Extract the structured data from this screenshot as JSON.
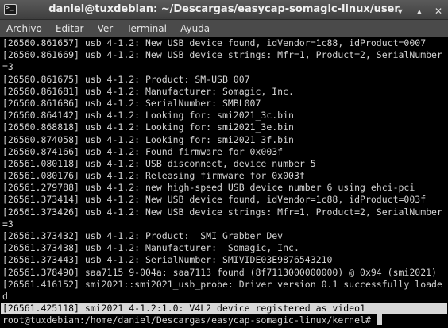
{
  "window": {
    "title": "daniel@tuxdebian: ~/Descargas/easycap-somagic-linux/user",
    "buttons": {
      "minimize": "▾",
      "maximize": "▴",
      "close": "✕"
    }
  },
  "menu": [
    "Archivo",
    "Editar",
    "Ver",
    "Terminal",
    "Ayuda"
  ],
  "terminal": {
    "lines": [
      "[26560.861657] usb 4-1.2: New USB device found, idVendor=1c88, idProduct=0007",
      "[26560.861669] usb 4-1.2: New USB device strings: Mfr=1, Product=2, SerialNumber",
      "=3",
      "[26560.861675] usb 4-1.2: Product: SM-USB 007",
      "[26560.861681] usb 4-1.2: Manufacturer: Somagic, Inc.",
      "[26560.861686] usb 4-1.2: SerialNumber: SMBL007",
      "[26560.864142] usb 4-1.2: Looking for: smi2021_3c.bin",
      "[26560.868818] usb 4-1.2: Looking for: smi2021_3e.bin",
      "[26560.874058] usb 4-1.2: Looking for: smi2021_3f.bin",
      "[26560.874166] usb 4-1.2: Found firmware for 0x003f",
      "[26561.080118] usb 4-1.2: USB disconnect, device number 5",
      "[26561.080176] usb 4-1.2: Releasing firmware for 0x003f",
      "[26561.279788] usb 4-1.2: new high-speed USB device number 6 using ehci-pci",
      "[26561.373414] usb 4-1.2: New USB device found, idVendor=1c88, idProduct=003f",
      "[26561.373426] usb 4-1.2: New USB device strings: Mfr=1, Product=2, SerialNumber",
      "=3",
      "[26561.373432] usb 4-1.2: Product:  SMI Grabber Dev",
      "[26561.373438] usb 4-1.2: Manufacturer:  Somagic, Inc.",
      "[26561.373443] usb 4-1.2: SerialNumber: SMIVIDE03E9876543210",
      "[26561.378490] saa7115 9-004a: saa7113 found (8f7113000000000) @ 0x94 (smi2021)",
      "[26561.416152] smi2021::smi2021_usb_probe: Driver version 0.1 successfully loade",
      "d"
    ],
    "selected_line": "[26561.425118] smi2021 4-1.2:1.0: V4L2 device registered as video1",
    "prompt": "root@tuxdebian:/home/daniel/Descargas/easycap-somagic-linux/kernel# "
  }
}
